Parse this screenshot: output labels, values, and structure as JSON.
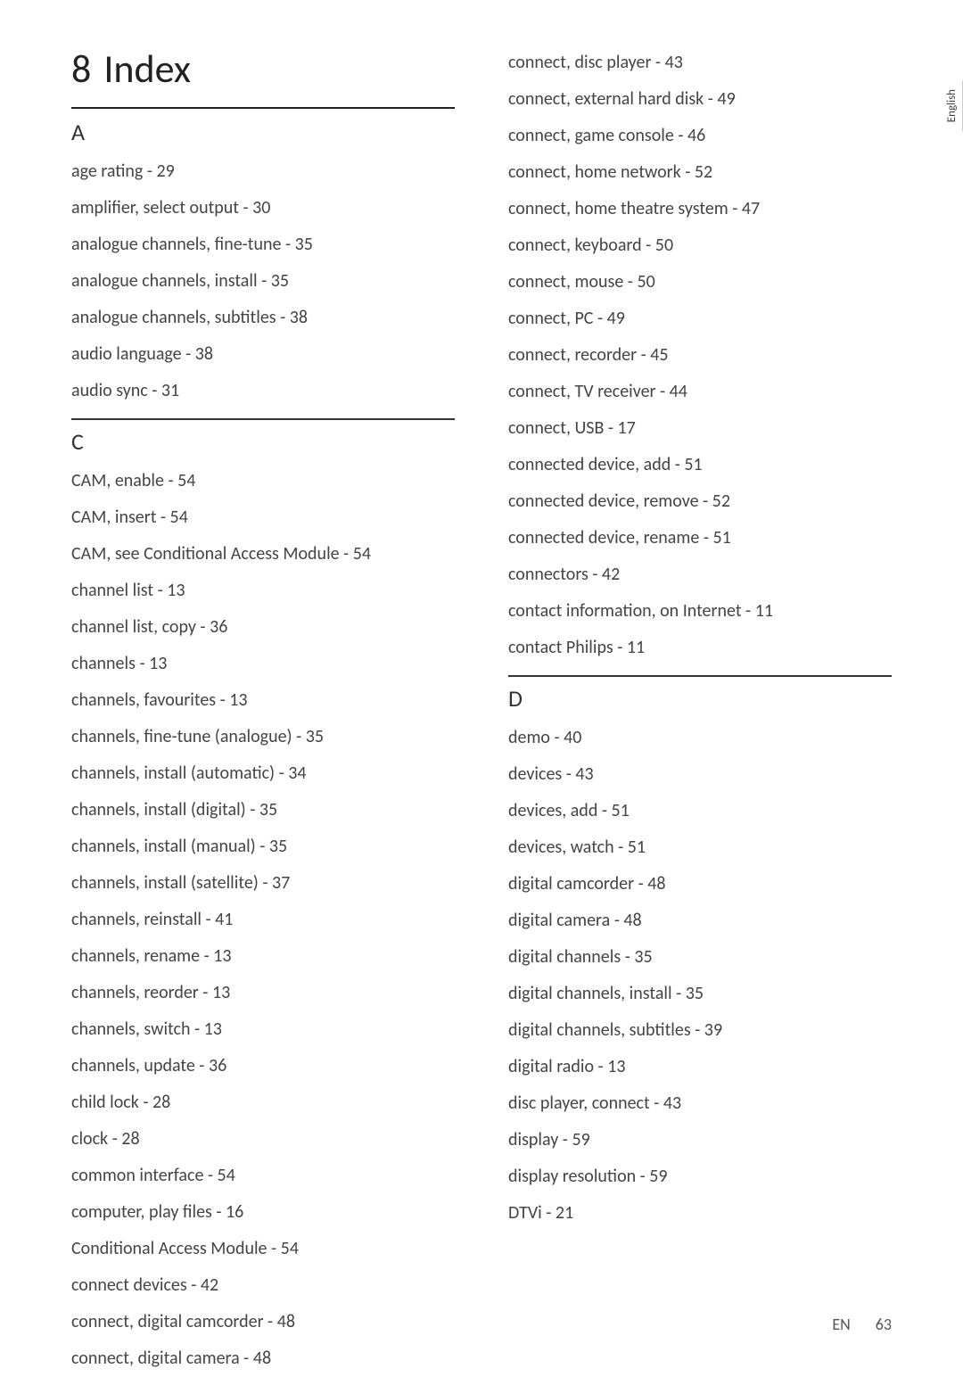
{
  "chapter": {
    "number": "8",
    "title": "Index"
  },
  "side_tab": "English",
  "footer": {
    "lang": "EN",
    "page": "63"
  },
  "col1": {
    "sections": [
      {
        "letter": "A",
        "entries": [
          "age rating - 29",
          "amplifier, select output - 30",
          "analogue channels, fine-tune - 35",
          "analogue channels, install - 35",
          "analogue channels, subtitles - 38",
          "audio language - 38",
          "audio sync - 31"
        ]
      },
      {
        "letter": "C",
        "entries": [
          "CAM, enable - 54",
          "CAM, insert - 54",
          "CAM, see Conditional Access Module - 54",
          "channel list - 13",
          "channel list, copy - 36",
          "channels - 13",
          "channels, favourites - 13",
          "channels, fine-tune (analogue) - 35",
          "channels, install (automatic) - 34",
          "channels, install (digital) - 35",
          "channels, install (manual) - 35",
          "channels, install (satellite) - 37",
          "channels, reinstall - 41",
          "channels, rename - 13",
          "channels, reorder - 13",
          "channels, switch - 13",
          "channels, update - 36",
          "child lock - 28",
          "clock - 28",
          "common interface - 54",
          "computer, play files - 16",
          "Conditional Access Module - 54",
          "connect devices - 42",
          "connect, digital camcorder - 48",
          "connect, digital camera - 48"
        ]
      }
    ]
  },
  "col2": {
    "lead_entries": [
      "connect, disc player - 43",
      "connect, external hard disk - 49",
      "connect, game console - 46",
      "connect, home network - 52",
      "connect, home theatre system - 47",
      "connect, keyboard - 50",
      "connect, mouse - 50",
      "connect, PC - 49",
      "connect, recorder - 45",
      "connect, TV receiver - 44",
      "connect, USB - 17",
      "connected device, add - 51",
      "connected device, remove - 52",
      "connected device, rename - 51",
      "connectors - 42",
      "contact information, on Internet - 11",
      "contact Philips - 11"
    ],
    "sections": [
      {
        "letter": "D",
        "entries": [
          "demo - 40",
          "devices - 43",
          "devices, add - 51",
          "devices, watch - 51",
          "digital camcorder - 48",
          "digital camera - 48",
          "digital channels - 35",
          "digital channels, install - 35",
          "digital channels, subtitles - 39",
          "digital radio - 13",
          "disc player, connect - 43",
          "display - 59",
          "display resolution - 59",
          "DTVi - 21"
        ]
      }
    ]
  }
}
